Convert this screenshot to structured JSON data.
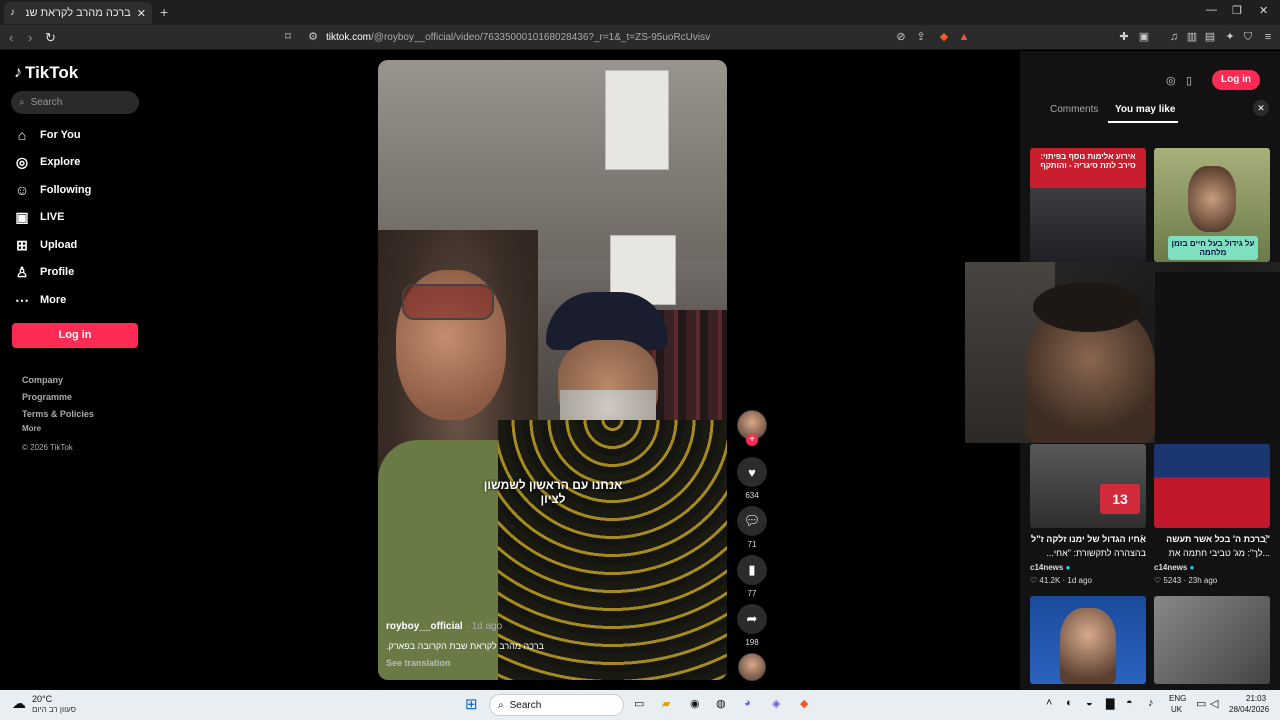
{
  "browser": {
    "tab_title": "ברכה מהרב לקראת שבת הקרוב",
    "url_host": "tiktok.com",
    "url_path": "/@royboy__official/video/7633500010168028436?_r=1&_t=ZS-95uoRcUvisv",
    "new_tab": "+",
    "close": "✕"
  },
  "sidebar": {
    "logo": "TikTok",
    "search_placeholder": "Search",
    "nav": [
      {
        "label": "For You",
        "icon": "home-icon"
      },
      {
        "label": "Explore",
        "icon": "compass-icon"
      },
      {
        "label": "Following",
        "icon": "user-follow-icon"
      },
      {
        "label": "LIVE",
        "icon": "live-icon"
      },
      {
        "label": "Upload",
        "icon": "upload-icon"
      },
      {
        "label": "Profile",
        "icon": "profile-icon"
      },
      {
        "label": "More",
        "icon": "more-icon"
      }
    ],
    "login": "Log in",
    "footer": [
      "Company",
      "Programme",
      "Terms & Policies",
      "More",
      "© 2026 TikTok"
    ]
  },
  "video": {
    "caption_overlay": "אנחנו עם הראשון לשמשון לציון",
    "author": "royboy__official",
    "age": "· 1d ago",
    "description": "ברכה מהרב לקראת שבת הקרובה בפארק.",
    "see_translation": "See translation"
  },
  "actions": {
    "likes": "634",
    "comments": "71",
    "saves": "77",
    "shares": "198"
  },
  "panel": {
    "login": "Log in",
    "tabs": [
      "Comments",
      "You may like"
    ],
    "active_tab": "You may like",
    "cards": [
      {
        "overlay": "אירוע אלימות נוסף בפיתוי: סירב לתת סיגריה - והותקף",
        "color": "#c81e2e"
      },
      {
        "overlay": "על גידול בעל חיים בזמן מלחמה",
        "color": "#3b6b4a"
      },
      {
        "title": "אחיו הגדול של ימנו זלקה ז\"ל",
        "subtitle": "בהצהרה לתקשורת: \"אחי...",
        "author": "c14news",
        "likes": "41.2K",
        "age": "· 1d ago"
      },
      {
        "title": "\"ברכת ה' בכל אשר תעשה",
        "subtitle": "...לך\": מג' טביבי חתמה את",
        "author": "c14news",
        "likes": "5243",
        "age": "· 23h ago"
      }
    ]
  },
  "taskbar": {
    "temp": "20°C",
    "weather": "סעוון רב היום",
    "search": "Search",
    "lang": "ENG",
    "region": "UK",
    "time": "21:03",
    "date": "28/04/2026"
  }
}
